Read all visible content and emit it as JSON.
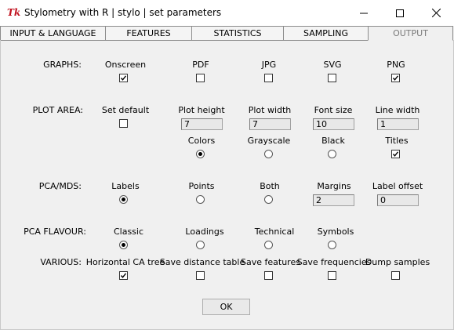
{
  "window": {
    "title": "Stylometry with R | stylo | set parameters",
    "icon": "Tk",
    "minimize_icon": "minimize-icon",
    "maximize_icon": "maximize-icon",
    "close_icon": "close-icon"
  },
  "tabs": [
    {
      "label": "INPUT & LANGUAGE",
      "active": false
    },
    {
      "label": "FEATURES",
      "active": false
    },
    {
      "label": "STATISTICS",
      "active": false
    },
    {
      "label": "SAMPLING",
      "active": false
    },
    {
      "label": "OUTPUT",
      "active": true
    }
  ],
  "graphs": {
    "label": "GRAPHS:",
    "items": [
      {
        "label": "Onscreen",
        "checked": true
      },
      {
        "label": "PDF",
        "checked": false
      },
      {
        "label": "JPG",
        "checked": false
      },
      {
        "label": "SVG",
        "checked": false
      },
      {
        "label": "PNG",
        "checked": true
      }
    ]
  },
  "plot_area": {
    "label": "PLOT AREA:",
    "set_default": {
      "label": "Set default",
      "checked": false
    },
    "fields": [
      {
        "label": "Plot height",
        "value": "7"
      },
      {
        "label": "Plot width",
        "value": "7"
      },
      {
        "label": "Font size",
        "value": "10"
      },
      {
        "label": "Line width",
        "value": "1"
      }
    ],
    "color_options": [
      {
        "label": "Colors",
        "selected": true
      },
      {
        "label": "Grayscale",
        "selected": false
      },
      {
        "label": "Black",
        "selected": false
      }
    ],
    "titles": {
      "label": "Titles",
      "checked": true
    }
  },
  "pca_mds": {
    "label": "PCA/MDS:",
    "options": [
      {
        "label": "Labels",
        "selected": true
      },
      {
        "label": "Points",
        "selected": false
      },
      {
        "label": "Both",
        "selected": false
      }
    ],
    "margins": {
      "label": "Margins",
      "value": "2"
    },
    "label_offset": {
      "label": "Label offset",
      "value": "0"
    }
  },
  "pca_flavour": {
    "label": "PCA FLAVOUR:",
    "options": [
      {
        "label": "Classic",
        "selected": true
      },
      {
        "label": "Loadings",
        "selected": false
      },
      {
        "label": "Technical",
        "selected": false
      },
      {
        "label": "Symbols",
        "selected": false
      }
    ]
  },
  "various": {
    "label": "VARIOUS:",
    "items": [
      {
        "label": "Horizontal CA tree",
        "checked": true
      },
      {
        "label": "Save distance table",
        "checked": false
      },
      {
        "label": "Save features",
        "checked": false
      },
      {
        "label": "Save frequencies",
        "checked": false
      },
      {
        "label": "Dump samples",
        "checked": false
      }
    ]
  },
  "ok_label": "OK"
}
